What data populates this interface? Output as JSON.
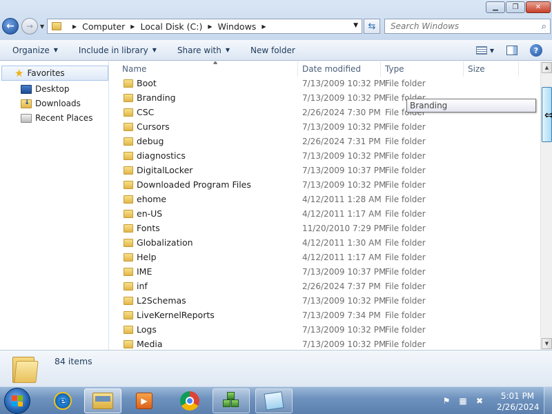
{
  "window": {
    "minimize_glyph": "▁",
    "maximize_glyph": "❐",
    "close_glyph": "✕"
  },
  "address": {
    "back_glyph": "←",
    "forward_glyph": "→",
    "crumbs": [
      "Computer",
      "Local Disk (C:)",
      "Windows"
    ],
    "search_placeholder": "Search Windows"
  },
  "toolbar": {
    "organize": "Organize",
    "include_in_library": "Include in library",
    "share_with": "Share with",
    "new_folder": "New folder"
  },
  "sidebar": {
    "favorites": "Favorites",
    "items": [
      {
        "label": "Desktop",
        "icon": "desktop-icon"
      },
      {
        "label": "Downloads",
        "icon": "downloads-icon"
      },
      {
        "label": "Recent Places",
        "icon": "recent-places-icon"
      }
    ]
  },
  "columns": {
    "name": "Name",
    "date": "Date modified",
    "type": "Type",
    "size": "Size"
  },
  "files": [
    {
      "name": "Boot",
      "date": "7/13/2009 10:32 PM",
      "type": "File folder"
    },
    {
      "name": "Branding",
      "date": "7/13/2009 10:32 PM",
      "type": "File folder"
    },
    {
      "name": "CSC",
      "date": "2/26/2024 7:30 PM",
      "type": "File folder"
    },
    {
      "name": "Cursors",
      "date": "7/13/2009 10:32 PM",
      "type": "File folder"
    },
    {
      "name": "debug",
      "date": "2/26/2024 7:31 PM",
      "type": "File folder"
    },
    {
      "name": "diagnostics",
      "date": "7/13/2009 10:32 PM",
      "type": "File folder"
    },
    {
      "name": "DigitalLocker",
      "date": "7/13/2009 10:37 PM",
      "type": "File folder"
    },
    {
      "name": "Downloaded Program Files",
      "date": "7/13/2009 10:32 PM",
      "type": "File folder"
    },
    {
      "name": "ehome",
      "date": "4/12/2011 1:28 AM",
      "type": "File folder"
    },
    {
      "name": "en-US",
      "date": "4/12/2011 1:17 AM",
      "type": "File folder"
    },
    {
      "name": "Fonts",
      "date": "11/20/2010 7:29 PM",
      "type": "File folder"
    },
    {
      "name": "Globalization",
      "date": "4/12/2011 1:30 AM",
      "type": "File folder"
    },
    {
      "name": "Help",
      "date": "4/12/2011 1:17 AM",
      "type": "File folder"
    },
    {
      "name": "IME",
      "date": "7/13/2009 10:37 PM",
      "type": "File folder"
    },
    {
      "name": "inf",
      "date": "2/26/2024 7:37 PM",
      "type": "File folder"
    },
    {
      "name": "L2Schemas",
      "date": "7/13/2009 10:32 PM",
      "type": "File folder"
    },
    {
      "name": "LiveKernelReports",
      "date": "7/13/2009 7:34 PM",
      "type": "File folder"
    },
    {
      "name": "Logs",
      "date": "7/13/2009 10:32 PM",
      "type": "File folder"
    },
    {
      "name": "Media",
      "date": "7/13/2009 10:32 PM",
      "type": "File folder"
    }
  ],
  "tooltip": "Branding",
  "status": {
    "item_count": "84 items"
  },
  "taskbar": {
    "apps": [
      "internet-explorer",
      "windows-explorer",
      "media-player",
      "chrome",
      "cubes-app",
      "notepad"
    ],
    "time": "5:01 PM",
    "date": "2/26/2024"
  }
}
